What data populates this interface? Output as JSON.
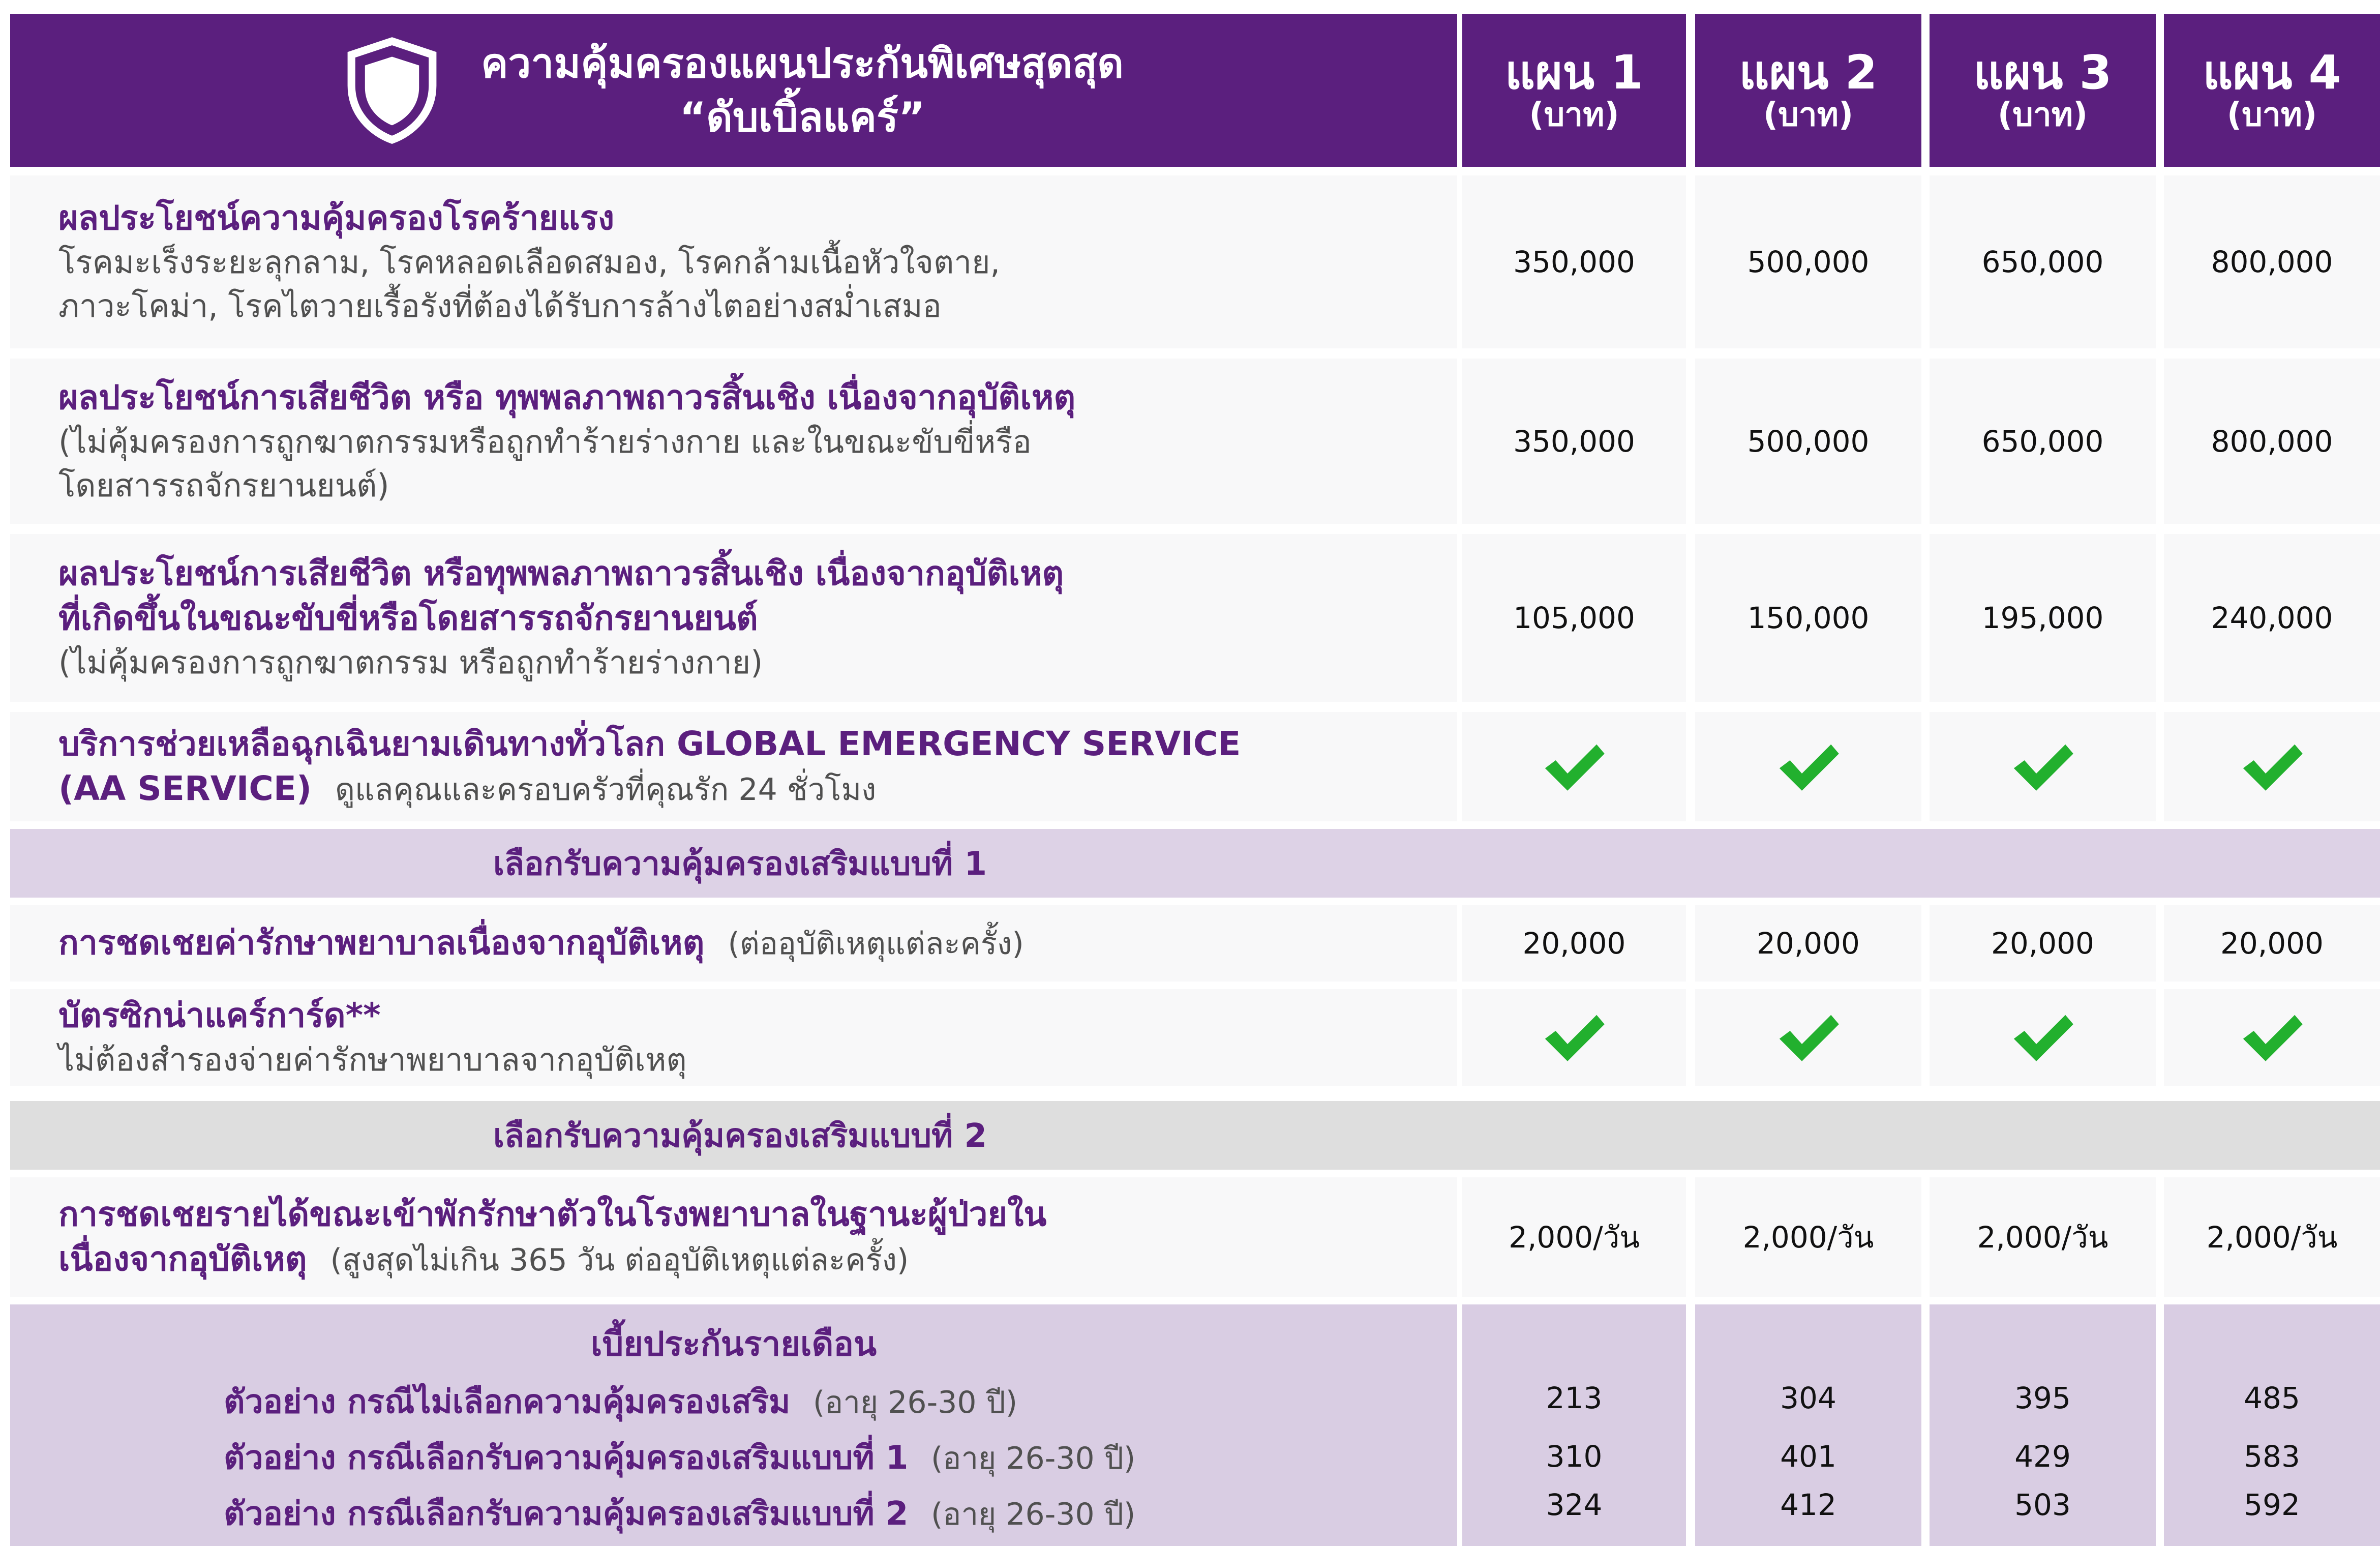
{
  "header": {
    "title_line1": "ความคุ้มครองแผนประกันพิเศษสุดสุด",
    "title_line2": "“ดับเบิ้ลแคร์”",
    "shield_icon": "shield-icon",
    "plans": [
      {
        "name": "แผน 1",
        "unit": "(บาท)"
      },
      {
        "name": "แผน 2",
        "unit": "(บาท)"
      },
      {
        "name": "แผน 3",
        "unit": "(บาท)"
      },
      {
        "name": "แผน 4",
        "unit": "(บาท)"
      }
    ]
  },
  "rows": [
    {
      "title": "ผลประโยชน์ความคุ้มครองโรคร้ายแรง",
      "sub1": "โรคมะเร็งระยะลุกลาม, โรคหลอดเลือดสมอง, โรคกล้ามเนื้อหัวใจตาย,",
      "sub2": "ภาวะโคม่า, โรคไตวายเรื้อรังที่ต้องได้รับการล้างไตอย่างสม่ำเสมอ",
      "values": [
        "350,000",
        "500,000",
        "650,000",
        "800,000"
      ]
    },
    {
      "title": "ผลประโยชน์การเสียชีวิต หรือ ทุพพลภาพถาวรสิ้นเชิง เนื่องจากอุบัติเหตุ",
      "sub1": "(ไม่คุ้มครองการถูกฆาตกรรมหรือถูกทำร้ายร่างกาย และในขณะขับขี่หรือ",
      "sub2": "โดยสารรถจักรยานยนต์)",
      "values": [
        "350,000",
        "500,000",
        "650,000",
        "800,000"
      ]
    },
    {
      "title1": "ผลประโยชน์การเสียชีวิต หรือทุพพลภาพถาวรสิ้นเชิง เนื่องจากอุบัติเหตุ",
      "title2": "ที่เกิดขึ้นในขณะขับขี่หรือโดยสารรถจักรยานยนต์",
      "sub1": "(ไม่คุ้มครองการถูกฆาตกรรม หรือถูกทำร้ายร่างกาย)",
      "values": [
        "105,000",
        "150,000",
        "195,000",
        "240,000"
      ]
    },
    {
      "title1": "บริการช่วยเหลือฉุกเฉินยามเดินทางทั่วโลก GLOBAL EMERGENCY SERVICE",
      "title2": "(AA SERVICE)",
      "inline": "ดูแลคุณและครอบครัวที่คุณรัก 24 ชั่วโมง",
      "check_icon": "check-icon"
    }
  ],
  "section1": {
    "title": "เลือกรับความคุ้มครองเสริมแบบที่ 1",
    "rows": [
      {
        "title": "การชดเชยค่ารักษาพยาบาลเนื่องจากอุบัติเหตุ",
        "inline": "(ต่ออุบัติเหตุแต่ละครั้ง)",
        "values": [
          "20,000",
          "20,000",
          "20,000",
          "20,000"
        ]
      },
      {
        "title": "บัตรซิกน่าแคร์การ์ด**",
        "sub1": "ไม่ต้องสำรองจ่ายค่ารักษาพยาบาลจากอุบัติเหตุ"
      }
    ]
  },
  "section2": {
    "title": "เลือกรับความคุ้มครองเสริมแบบที่ 2",
    "row": {
      "title1": "การชดเชยรายได้ขณะเข้าพักรักษาตัวในโรงพยาบาลในฐานะผู้ป่วยใน",
      "title2": "เนื่องจากอุบัติเหตุ",
      "inline": "(สูงสุดไม่เกิน 365 วัน ต่ออุบัติเหตุแต่ละครั้ง)",
      "values": [
        "2,000/วัน",
        "2,000/วัน",
        "2,000/วัน",
        "2,000/วัน"
      ]
    }
  },
  "premium": {
    "title": "เบี้ยประกันรายเดือน",
    "lines": [
      {
        "label": "ตัวอย่าง กรณีไม่เลือกความคุ้มครองเสริม",
        "age": "(อายุ 26-30 ปี)",
        "values": [
          "213",
          "304",
          "395",
          "485"
        ]
      },
      {
        "label": "ตัวอย่าง กรณีเลือกรับความคุ้มครองเสริมแบบที่ 1",
        "age": "(อายุ 26-30 ปี)",
        "values": [
          "310",
          "401",
          "429",
          "583"
        ]
      },
      {
        "label": "ตัวอย่าง กรณีเลือกรับความคุ้มครองเสริมแบบที่ 2",
        "age": "(อายุ 26-30 ปี)",
        "values": [
          "324",
          "412",
          "503",
          "592"
        ]
      }
    ]
  },
  "colors": {
    "purple": "#5b1f7e",
    "check_green": "#22b02e",
    "lavender": "#ddd2e6",
    "grey": "#dedede"
  }
}
